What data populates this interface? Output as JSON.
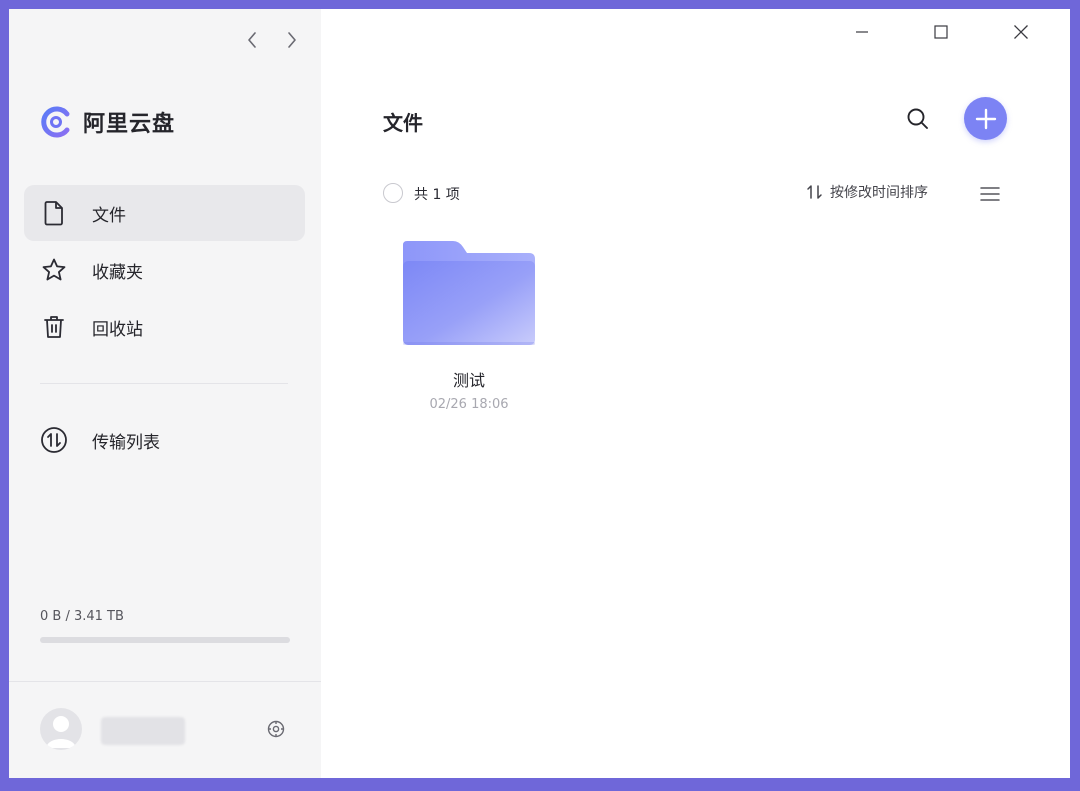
{
  "app": {
    "name": "阿里云盘",
    "brand_color": "#6f74f5"
  },
  "sidebar": {
    "items": [
      {
        "label": "文件",
        "icon": "file-icon",
        "active": true
      },
      {
        "label": "收藏夹",
        "icon": "star-icon",
        "active": false
      },
      {
        "label": "回收站",
        "icon": "trash-icon",
        "active": false
      }
    ],
    "transfer": {
      "label": "传输列表",
      "icon": "transfer-icon"
    },
    "storage": {
      "used_text": "0 B / 3.41 TB",
      "used_fraction": 0
    }
  },
  "main": {
    "title": "文件",
    "item_count": "共 1 项",
    "sort_label": "按修改时间排序",
    "files": [
      {
        "name": "测试",
        "date": "02/26 18:06",
        "type": "folder"
      }
    ]
  },
  "colors": {
    "accent": "#7c83f4",
    "folder_top": "#8f97fb",
    "folder_front": "#7f88f7"
  }
}
